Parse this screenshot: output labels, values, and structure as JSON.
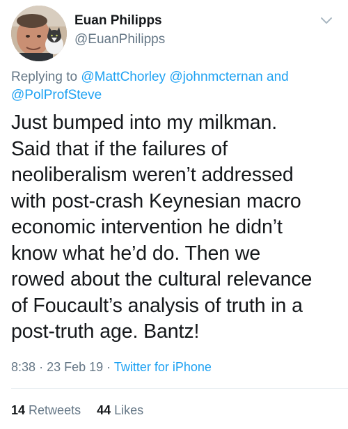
{
  "author": {
    "display_name": "Euan Philipps",
    "handle": "@EuanPhilipps"
  },
  "reply": {
    "prefix": "Replying to",
    "mention_1": "@MattChorley",
    "mention_2": "@johnmcternan",
    "conjunction": "and",
    "mention_3": "@PolProfSteve"
  },
  "tweet": {
    "lines": [
      "Just bumped into my milkman.",
      "Said that if the failures of",
      "neoliberalism weren’t addressed",
      "with post-crash Keynesian macro",
      "economic intervention he didn’t",
      "know what he’d do. Then we",
      "rowed about the cultural relevance",
      "of Foucault’s analysis of truth in a",
      "post-truth age. Bantz!"
    ]
  },
  "meta": {
    "time": "8:38",
    "separator": "·",
    "date": "23 Feb 19",
    "source": "Twitter for iPhone"
  },
  "stats": {
    "retweets_count": "14",
    "retweets_label": "Retweets",
    "likes_count": "44",
    "likes_label": "Likes"
  },
  "colors": {
    "link": "#1da1f2",
    "secondary": "#657786",
    "text": "#14171a"
  },
  "icons": {
    "more": "chevron-down-icon"
  }
}
